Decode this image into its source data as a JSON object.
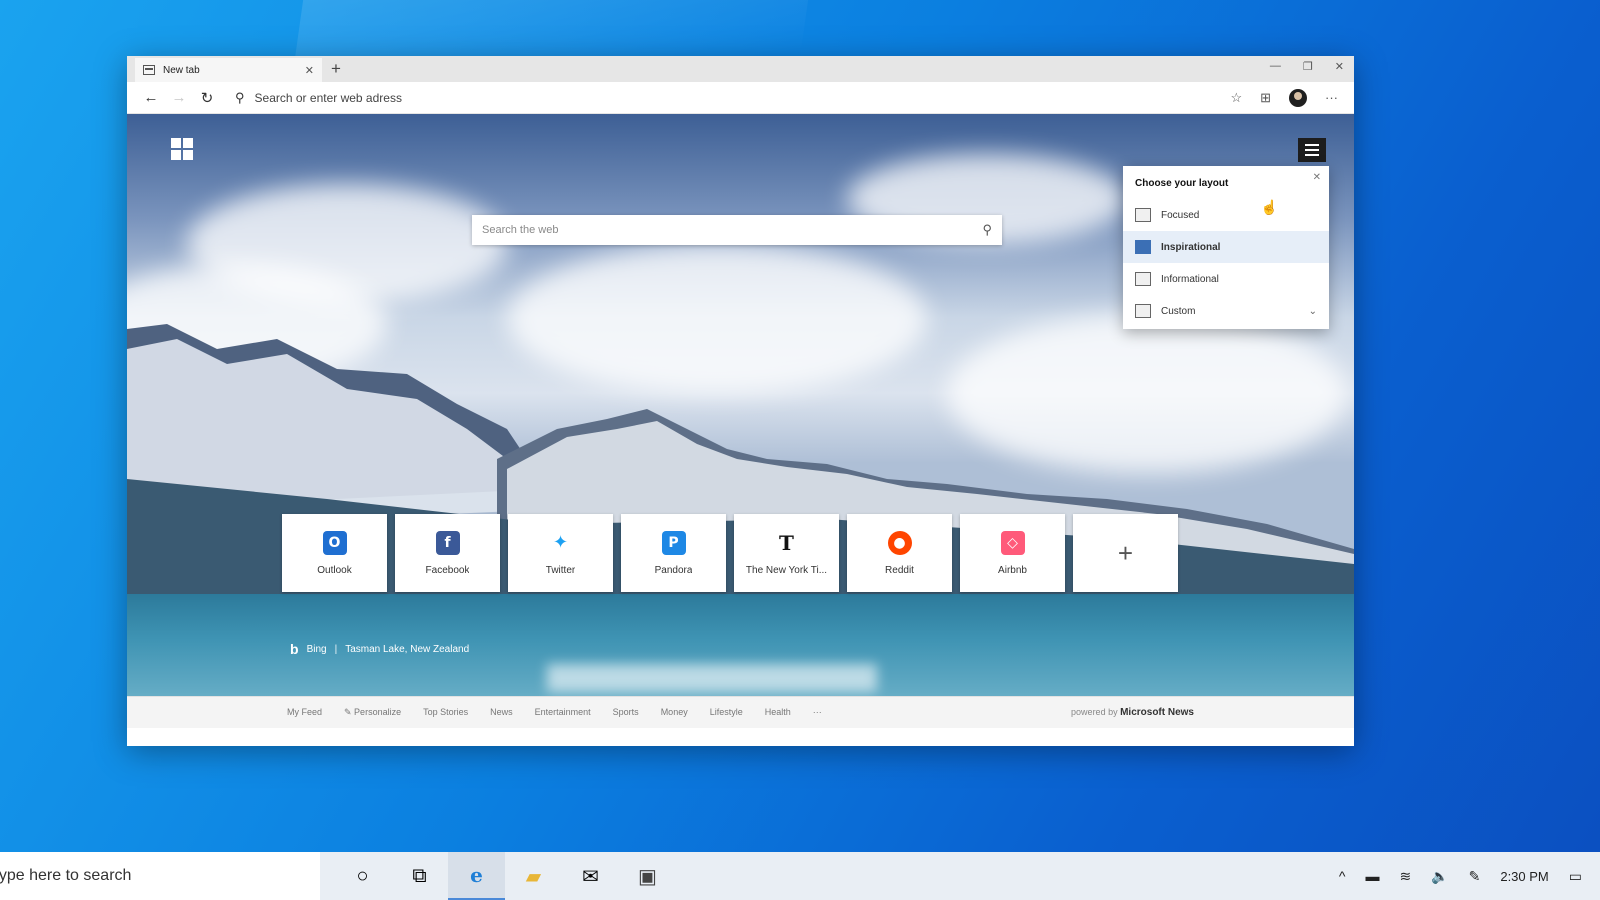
{
  "browser": {
    "tab_title": "New tab",
    "new_tab_symbol": "+",
    "address_placeholder": "Search or enter web adress",
    "window_controls": [
      "—",
      "❐",
      "✕"
    ]
  },
  "ntp": {
    "search_placeholder": "Search the web",
    "layout_panel": {
      "title": "Choose your layout",
      "options": [
        {
          "label": "Focused",
          "active": false
        },
        {
          "label": "Inspirational",
          "active": true
        },
        {
          "label": "Informational",
          "active": false
        },
        {
          "label": "Custom",
          "active": false
        }
      ]
    },
    "quick_links": [
      {
        "label": "Outlook",
        "icon": "outlook-icon",
        "color": "#1f6fd1"
      },
      {
        "label": "Facebook",
        "icon": "facebook-icon",
        "color": "#3b5998"
      },
      {
        "label": "Twitter",
        "icon": "twitter-icon",
        "color": "#1da1f2"
      },
      {
        "label": "Pandora",
        "icon": "pandora-icon",
        "color": "#1e88e5"
      },
      {
        "label": "The New York Ti...",
        "icon": "nytimes-icon",
        "color": "#111111"
      },
      {
        "label": "Reddit",
        "icon": "reddit-icon",
        "color": "#ff4500"
      },
      {
        "label": "Airbnb",
        "icon": "airbnb-icon",
        "color": "#ff5a7a"
      }
    ],
    "credit": {
      "brand": "Bing",
      "divider": "|",
      "location": "Tasman Lake, New Zealand"
    },
    "news_categories": [
      "My Feed",
      "✎ Personalize",
      "Top Stories",
      "News",
      "Entertainment",
      "Sports",
      "Money",
      "Lifestyle",
      "Health",
      "···"
    ],
    "powered_by_prefix": "powered by",
    "powered_by_brand": "Microsoft News"
  },
  "taskbar": {
    "search_text": "Type here to search",
    "apps": [
      "cortana-icon",
      "task-view-icon",
      "edge-icon",
      "file-explorer-icon",
      "mail-icon",
      "store-icon"
    ],
    "time": "2:30 PM"
  }
}
